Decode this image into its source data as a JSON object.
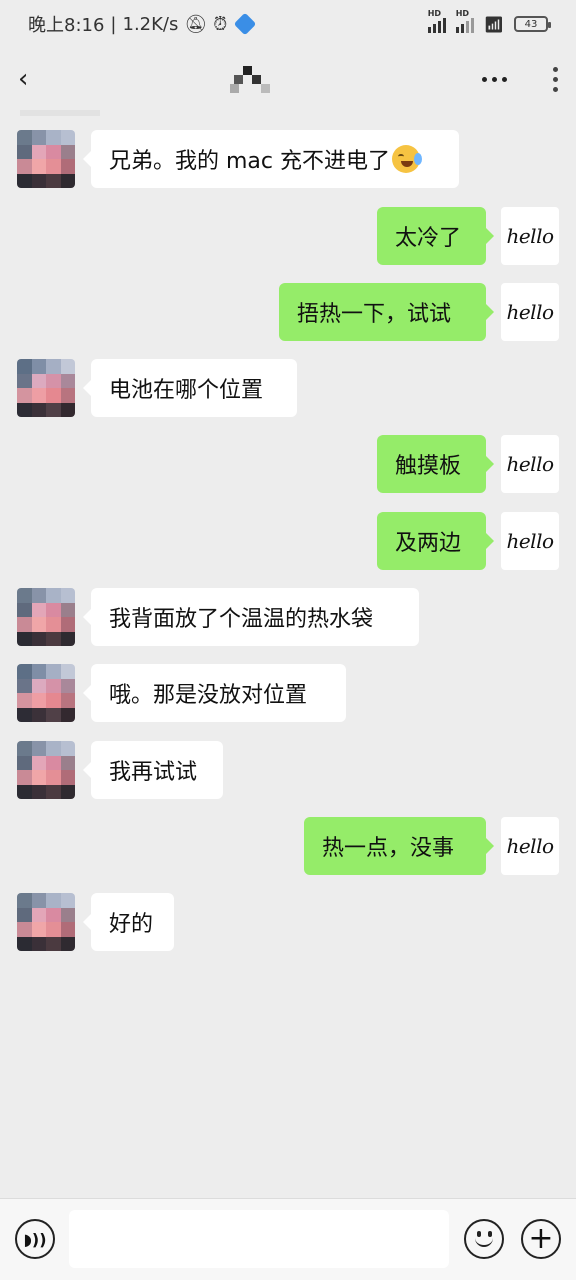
{
  "status_bar": {
    "time": "晚上8:16",
    "net_speed": "1.2K/s",
    "battery": "43"
  },
  "nav": {
    "back_icon": "‹",
    "title": "",
    "more_icon": "···"
  },
  "messages": [
    {
      "side": "left",
      "text": "兄弟。我的 mac 充不进电了",
      "emoji": "crying-laughing-emoji"
    },
    {
      "side": "right",
      "text": "太冷了"
    },
    {
      "side": "right",
      "text": "捂热一下，试试"
    },
    {
      "side": "left",
      "text": "电池在哪个位置"
    },
    {
      "side": "right",
      "text": "触摸板"
    },
    {
      "side": "right",
      "text": "及两边"
    },
    {
      "side": "left",
      "text": "我背面放了个温温的热水袋"
    },
    {
      "side": "left",
      "text": "哦。那是没放对位置"
    },
    {
      "side": "left",
      "text": "我再试试"
    },
    {
      "side": "right",
      "text": "热一点，没事"
    },
    {
      "side": "left",
      "text": "好的"
    }
  ],
  "self_avatar_text": "hello",
  "input_bar": {
    "voice_icon": "voice-icon",
    "input_value": "",
    "emoji_icon": "emoji-icon",
    "plus_icon": "+"
  },
  "colors": {
    "background": "#ededed",
    "self_bubble": "#95ec69",
    "other_bubble": "#ffffff"
  }
}
